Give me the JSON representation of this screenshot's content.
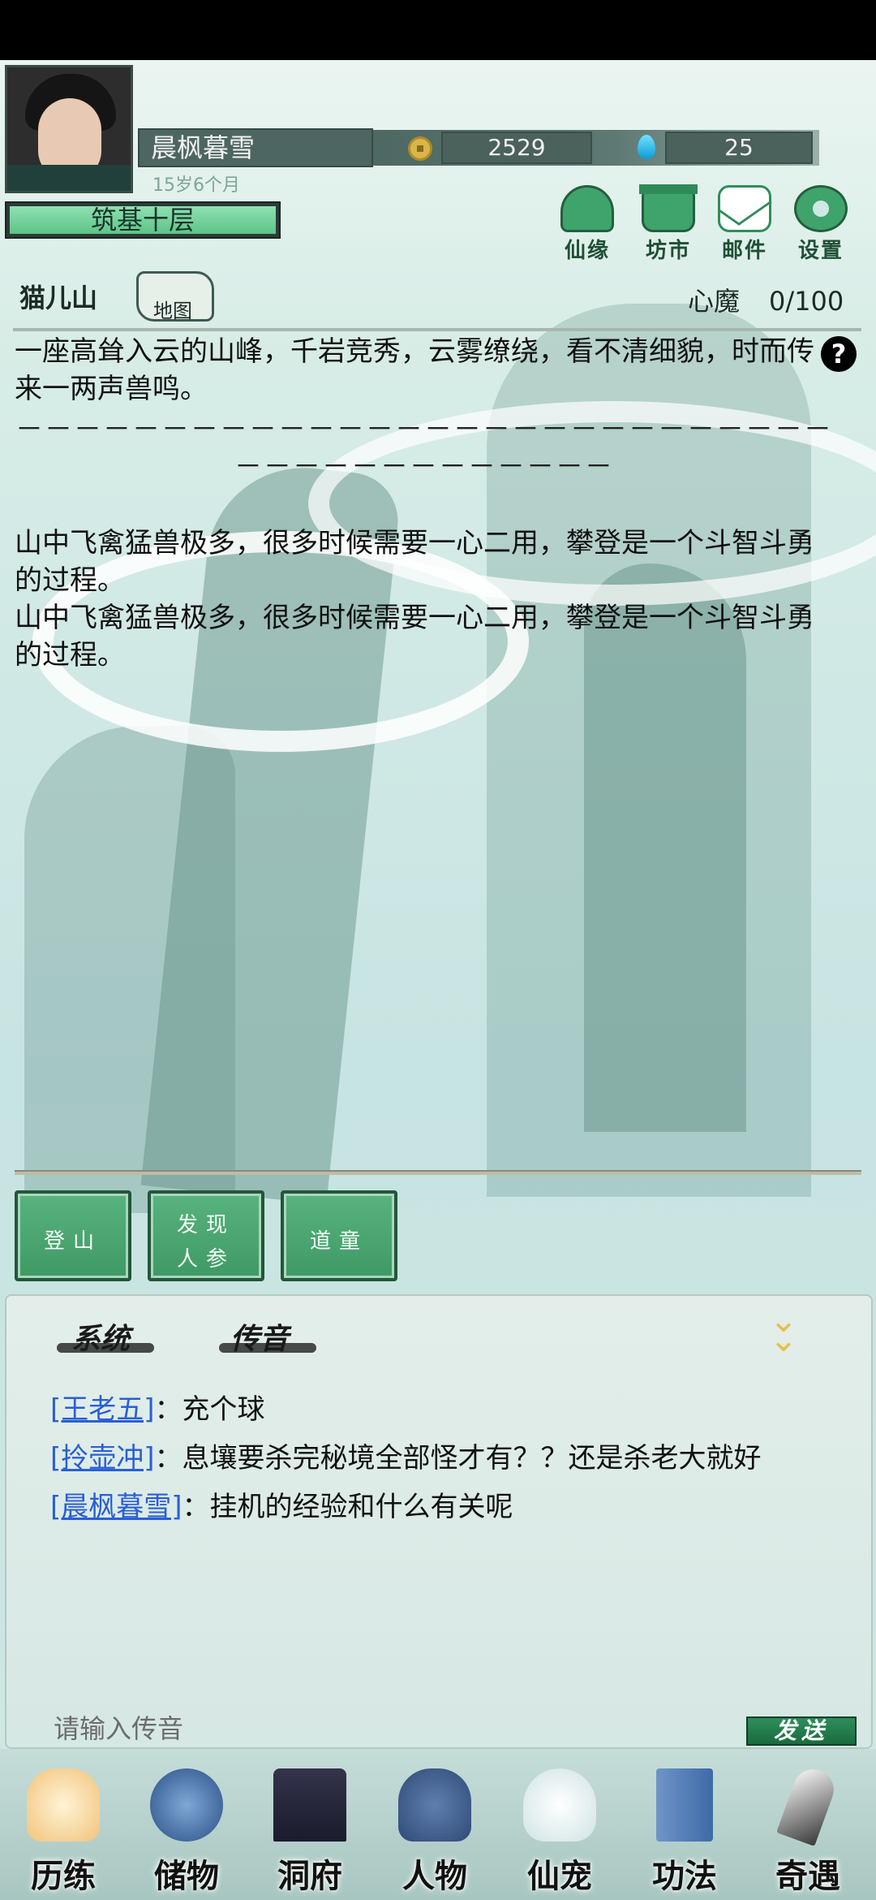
{
  "player": {
    "name": "晨枫暮雪",
    "age": "15岁6个月",
    "realm": "筑基十层",
    "coins": "2529",
    "gems": "25"
  },
  "top_buttons": [
    {
      "label": "仙缘",
      "icon": "immortal-fate-icon"
    },
    {
      "label": "坊市",
      "icon": "market-icon"
    },
    {
      "label": "邮件",
      "icon": "mail-icon"
    },
    {
      "label": "设置",
      "icon": "gear-icon"
    }
  ],
  "location": {
    "name": "猫儿山",
    "map_label": "地图",
    "demon_label": "心魔",
    "demon_value": "0/100"
  },
  "story": {
    "intro": "一座高耸入云的山峰，千岩竞秀，云雾缭绕，看不清细貌，时而传来一两声兽鸣。",
    "divider": "－－－－－－－－－－－－－－－－－－－－－－－－－－－－－－－－－－－－－－－－－",
    "lines": [
      "山中飞禽猛兽极多，很多时候需要一心二用，攀登是一个斗智斗勇的过程。",
      "山中飞禽猛兽极多，很多时候需要一心二用，攀登是一个斗智斗勇的过程。"
    ]
  },
  "actions": [
    {
      "line1": "登山",
      "line2": ""
    },
    {
      "line1": "发现",
      "line2": "人参"
    },
    {
      "line1": "道童",
      "line2": ""
    }
  ],
  "chat": {
    "tabs": [
      "系统",
      "传音"
    ],
    "messages": [
      {
        "user": "[王老五]",
        "text": "：充个球"
      },
      {
        "user": "[拎壶冲]",
        "text": "：息壤要杀完秘境全部怪才有？？还是杀老大就好"
      },
      {
        "user": "[晨枫暮雪]",
        "text": "：挂机的经验和什么有关呢"
      }
    ],
    "input_placeholder": "请输入传音",
    "send_label": "发送"
  },
  "nav": [
    {
      "label": "历练",
      "icon": "training-icon"
    },
    {
      "label": "储物",
      "icon": "storage-bag-icon"
    },
    {
      "label": "洞府",
      "icon": "cave-house-icon"
    },
    {
      "label": "人物",
      "icon": "character-icon"
    },
    {
      "label": "仙宠",
      "icon": "pet-icon"
    },
    {
      "label": "功法",
      "icon": "technique-book-icon"
    },
    {
      "label": "奇遇",
      "icon": "adventure-icon"
    }
  ],
  "colors": {
    "accent_green": "#3fa46b",
    "link_blue": "#2a5fd6",
    "realm_fill": "#5ec487"
  }
}
